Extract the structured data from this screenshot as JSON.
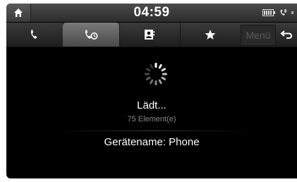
{
  "statusbar": {
    "time": "04:59",
    "icons": [
      "home-icon",
      "battery-icon",
      "bluetooth-phone-icon",
      "signal-icon"
    ]
  },
  "tabs": [
    {
      "name": "call-history",
      "icon": "phone-handset-icon"
    },
    {
      "name": "recent-calls",
      "icon": "phone-clock-icon",
      "active": true
    },
    {
      "name": "contacts",
      "icon": "contacts-book-icon"
    },
    {
      "name": "favorites",
      "icon": "star-icon"
    }
  ],
  "toolbar": {
    "menu_label": "Menü",
    "back_icon": "back-arrow-icon"
  },
  "content": {
    "loading_label": "Lädt...",
    "item_count": "75 Element(e)",
    "device_name": "Gerätename: Phone"
  },
  "colors": {
    "background": "#000000",
    "text": "#ffffff",
    "muted_text": "#888888",
    "disabled_menu": "#5a5a5a"
  }
}
